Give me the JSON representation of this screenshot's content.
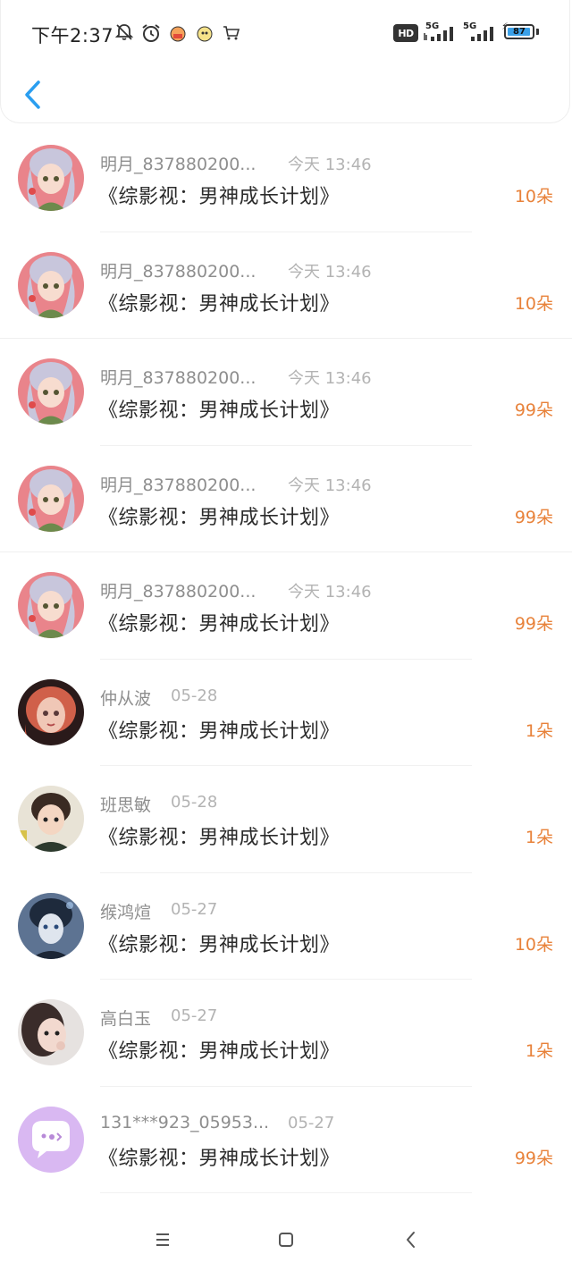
{
  "status_bar": {
    "time": "下午2:37",
    "icons": [
      "mute-bell-icon",
      "alarm-clock-icon",
      "app-notification-icon",
      "app-notification-icon",
      "shopping-cart-icon"
    ],
    "hd_label": "HD",
    "network_1": "5G",
    "network_2": "5G",
    "battery": "87"
  },
  "header": {
    "back_icon": "chevron-left-icon",
    "accent_color": "#2a9ef0"
  },
  "colors": {
    "amount": "#e8823a",
    "name": "#8e8e8e",
    "time": "#b3b3b3",
    "title": "#2b2b2b"
  },
  "rows": [
    {
      "name": "明月_837880200...",
      "time": "今天 13:46",
      "title": "《综影视：男神成长计划》",
      "amount": "10朵",
      "avatar": "girl-avatar"
    },
    {
      "name": "明月_837880200...",
      "time": "今天 13:46",
      "title": "《综影视：男神成长计划》",
      "amount": "10朵",
      "avatar": "girl-avatar"
    },
    {
      "name": "明月_837880200...",
      "time": "今天 13:46",
      "title": "《综影视：男神成长计划》",
      "amount": "99朵",
      "avatar": "girl-avatar"
    },
    {
      "name": "明月_837880200...",
      "time": "今天 13:46",
      "title": "《综影视：男神成长计划》",
      "amount": "99朵",
      "avatar": "girl-avatar"
    },
    {
      "name": "明月_837880200...",
      "time": "今天 13:46",
      "title": "《综影视：男神成长计划》",
      "amount": "99朵",
      "avatar": "girl-avatar"
    },
    {
      "name": "仲从波",
      "time": "05-28",
      "title": "《综影视：男神成长计划》",
      "amount": "1朵",
      "avatar": "red-hair-avatar"
    },
    {
      "name": "班思敏",
      "time": "05-28",
      "title": "《综影视：男神成长计划》",
      "amount": "1朵",
      "avatar": "child-avatar"
    },
    {
      "name": "缑鸿煊",
      "time": "05-27",
      "title": "《综影视：男神成长计划》",
      "amount": "10朵",
      "avatar": "anime-boy-avatar"
    },
    {
      "name": "高白玉",
      "time": "05-27",
      "title": "《综影视：男神成长计划》",
      "amount": "1朵",
      "avatar": "woman-avatar"
    },
    {
      "name": "131***923_05953...",
      "time": "05-27",
      "title": "《综影视：男神成长计划》",
      "amount": "99朵",
      "avatar": "chat-bubble-avatar"
    }
  ],
  "nav": {
    "menu_icon": "menu-icon",
    "home_icon": "home-square-icon",
    "back_icon": "back-triangle-icon"
  }
}
